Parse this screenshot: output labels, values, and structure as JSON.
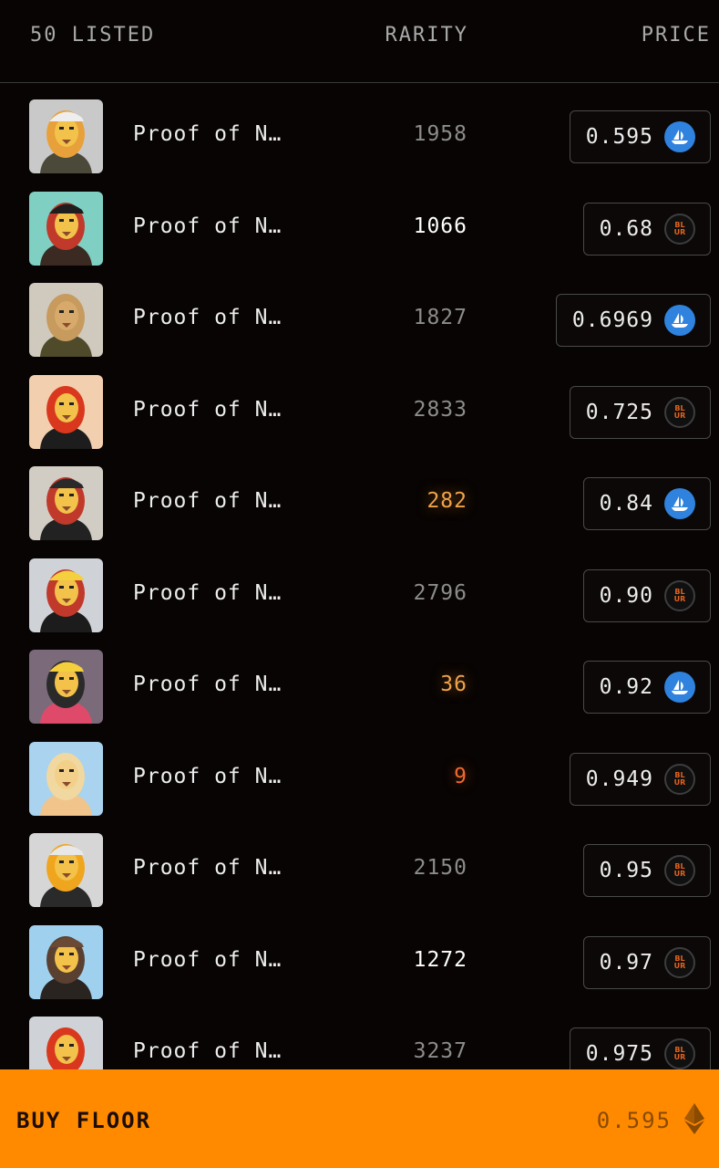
{
  "header": {
    "listed": "50 LISTED",
    "rarity": "RARITY",
    "price": "PRICE"
  },
  "items": [
    {
      "name": "Proof of N…",
      "rarity": "1958",
      "rarity_tone": "grey",
      "price": "0.595",
      "market": "opensea",
      "avatar": "light-grey-bg-white-cap-lion"
    },
    {
      "name": "Proof of N…",
      "rarity": "1066",
      "rarity_tone": "white",
      "price": "0.68",
      "market": "blur",
      "avatar": "backyard-bg-black-cap-lion"
    },
    {
      "name": "Proof of N…",
      "rarity": "1827",
      "rarity_tone": "grey",
      "price": "0.6969",
      "market": "opensea",
      "avatar": "room-bg-olive-jacket-lion"
    },
    {
      "name": "Proof of N…",
      "rarity": "2833",
      "rarity_tone": "grey",
      "price": "0.725",
      "market": "blur",
      "avatar": "peach-bg-red-mane-lion"
    },
    {
      "name": "Proof of N…",
      "rarity": "282",
      "rarity_tone": "gold",
      "price": "0.84",
      "market": "opensea",
      "avatar": "room-bg-headphones-lion"
    },
    {
      "name": "Proof of N…",
      "rarity": "2796",
      "rarity_tone": "grey",
      "price": "0.90",
      "market": "blur",
      "avatar": "grey-bg-gbr-cap-lion"
    },
    {
      "name": "Proof of N…",
      "rarity": "36",
      "rarity_tone": "gold",
      "price": "0.92",
      "market": "opensea",
      "avatar": "purple-bg-mask-gbr-lion"
    },
    {
      "name": "Proof of N…",
      "rarity": "9",
      "rarity_tone": "red",
      "price": "0.949",
      "market": "blur",
      "avatar": "blue-bg-bare-chest-lion"
    },
    {
      "name": "Proof of N…",
      "rarity": "2150",
      "rarity_tone": "grey",
      "price": "0.95",
      "market": "blur",
      "avatar": "grey-bg-glasses-gold-mane-lion"
    },
    {
      "name": "Proof of N…",
      "rarity": "1272",
      "rarity_tone": "white",
      "price": "0.97",
      "market": "blur",
      "avatar": "blue-glow-bg-shades-lion"
    },
    {
      "name": "Proof of N…",
      "rarity": "3237",
      "rarity_tone": "grey",
      "price": "0.975",
      "market": "blur",
      "avatar": "grey-bg-red-mane-lion"
    }
  ],
  "market_badges": {
    "blur_line1": "BL",
    "blur_line2": "UR"
  },
  "footer": {
    "buy_label": "BUY FLOOR",
    "floor_price": "0.595",
    "currency_icon": "ethereum-icon"
  },
  "colors": {
    "accent": "#ff8a00",
    "background": "#070403",
    "opensea": "#2f82dd",
    "blur": "#e2621d"
  }
}
